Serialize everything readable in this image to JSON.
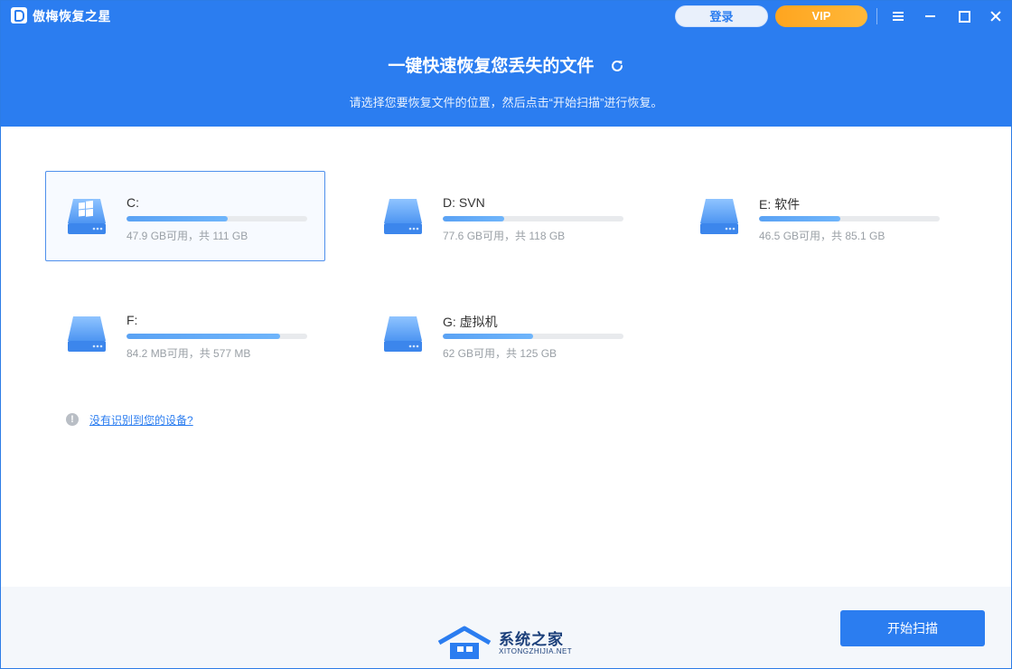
{
  "app": {
    "title": "傲梅恢复之星"
  },
  "header": {
    "login_label": "登录",
    "vip_label": "VIP",
    "main_title": "一键快速恢复您丢失的文件",
    "subtitle": "请选择您要恢复文件的位置，然后点击“开始扫描”进行恢复。"
  },
  "drives": [
    {
      "name": "C:",
      "capacity": "47.9 GB可用，共 111 GB",
      "used_percent": 56,
      "selected": true,
      "icon": "windows-drive-icon"
    },
    {
      "name": "D: SVN",
      "capacity": "77.6 GB可用，共 118 GB",
      "used_percent": 34,
      "selected": false,
      "icon": "drive-icon"
    },
    {
      "name": "E: 软件",
      "capacity": "46.5 GB可用，共 85.1 GB",
      "used_percent": 45,
      "selected": false,
      "icon": "drive-icon"
    },
    {
      "name": "F:",
      "capacity": "84.2 MB可用，共 577 MB",
      "used_percent": 85,
      "selected": false,
      "icon": "drive-icon"
    },
    {
      "name": "G: 虚拟机",
      "capacity": "62 GB可用，共 125 GB",
      "used_percent": 50,
      "selected": false,
      "icon": "drive-icon"
    }
  ],
  "help": {
    "link_text": "没有识别到您的设备?"
  },
  "footer": {
    "start_label": "开始扫描"
  },
  "watermark": {
    "text": "系统之家",
    "sub": "XITONGZHIJIA.NET"
  },
  "colors": {
    "brand": "#2b7df0",
    "vip": "#ffa51f",
    "bar": "#5aa2f4",
    "footer_bg": "#f4f7fb"
  }
}
